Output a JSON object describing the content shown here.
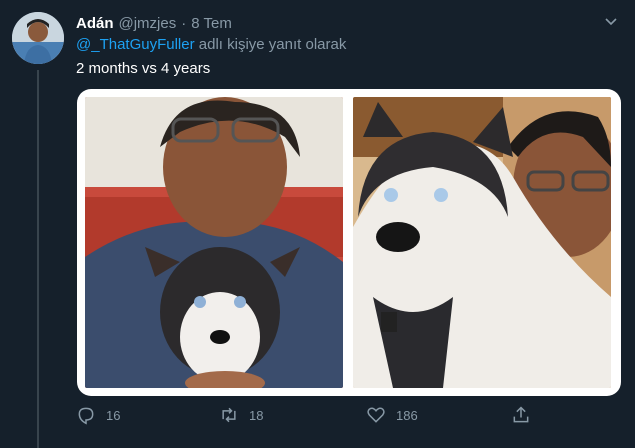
{
  "tweet": {
    "author_name": "Adán",
    "author_handle": "@jmzjes",
    "separator": "·",
    "date": "8 Tem",
    "reply_mention": "@_ThatGuyFuller",
    "reply_suffix": "adlı kişiye yanıt olarak",
    "text": "2 months vs 4 years"
  },
  "actions": {
    "replies": "16",
    "retweets": "18",
    "likes": "186"
  },
  "colors": {
    "background": "#15202b",
    "secondary_text": "#8899a6",
    "accent": "#1da1f2"
  },
  "icons": [
    "chevron-down-icon",
    "reply-icon",
    "retweet-icon",
    "like-icon",
    "share-icon"
  ]
}
